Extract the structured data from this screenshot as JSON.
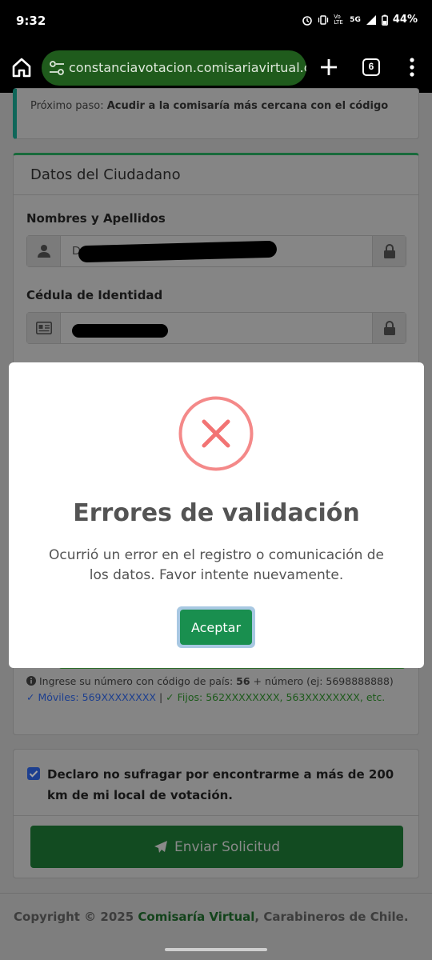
{
  "status_bar": {
    "time": "9:32",
    "network_volte": "Vo LTE",
    "network_gen": "5G",
    "battery": "44%"
  },
  "browser": {
    "url": "constanciavotacion.comisariavirtual.cl/votac",
    "tab_count": "6"
  },
  "step_card": {
    "prefix": "Próximo paso:",
    "text": "Acudir a la comisaría más cercana con el código"
  },
  "citizen_card": {
    "header": "Datos del Ciudadano",
    "name_label": "Nombres y Apellidos",
    "name_value_visible": "D",
    "id_label": "Cédula de Identidad"
  },
  "contact_card": {
    "hint_prefix": "Ingrese su número con código de país:",
    "hint_code": "56",
    "hint_suffix": "+ número (ej: 5698888888)",
    "mobiles": "✓ Móviles: 569XXXXXXXX",
    "separator": "|",
    "fixed": "✓ Fijos: 562XXXXXXXX, 563XXXXXXXX, etc."
  },
  "declaration": {
    "text": "Declaro no sufragar por encontrarme a más de 200 km de mi local de votación.",
    "checked": true
  },
  "send_button": {
    "label": "Enviar Solicitud"
  },
  "footer": {
    "prefix": "Copyright © 2025",
    "brand": "Comisaría Virtual",
    "suffix": ", Carabineros de Chile."
  },
  "modal": {
    "title": "Errores de validación",
    "message": "Ocurrió un error en el registro o comunicación de los datos. Favor intente nuevamente.",
    "button": "Aceptar",
    "icon_color": "#f27474",
    "button_color": "#198f4f"
  }
}
